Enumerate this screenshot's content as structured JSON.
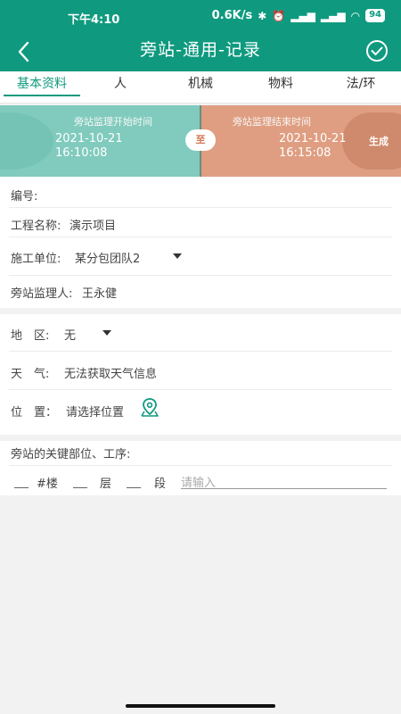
{
  "status_bar": {
    "time": "下午4:10",
    "net_speed": "0.6K/s",
    "battery": "94"
  },
  "nav": {
    "title": "旁站-通用-记录",
    "back_icon": "chevron-left-icon",
    "confirm_icon": "check-circle-icon"
  },
  "tabs": [
    {
      "label": "基本资料",
      "active": true
    },
    {
      "label": "人"
    },
    {
      "label": "机械"
    },
    {
      "label": "物料"
    },
    {
      "label": "法/环"
    }
  ],
  "time_banner": {
    "start_label": "旁站监理开始时间",
    "start_date": "2021-10-21",
    "start_time": "16:10:08",
    "to_label": "至",
    "end_label": "旁站监理结束时间",
    "end_date": "2021-10-21",
    "end_time": "16:15:08",
    "generate_label": "生成"
  },
  "form": {
    "number_label": "编号:",
    "project_label": "工程名称:",
    "project_value": "演示项目",
    "unit_label": "施工单位:",
    "unit_value": "某分包团队2",
    "supervisor_label": "旁站监理人:",
    "supervisor_value": "王永健",
    "area_label": "地　区:",
    "area_value": "无",
    "weather_label": "天　气:",
    "weather_value": "无法获取天气信息",
    "location_label": "位　置：",
    "location_value": "请选择位置",
    "key_label": "旁站的关键部位、工序:",
    "building_unit": "#楼",
    "floor_unit": "层",
    "section_unit": "段",
    "input_placeholder": "请输入"
  },
  "colors": {
    "primary": "#0f9a7f",
    "start_bg": "#80cbbd",
    "end_bg": "#df9e81"
  }
}
